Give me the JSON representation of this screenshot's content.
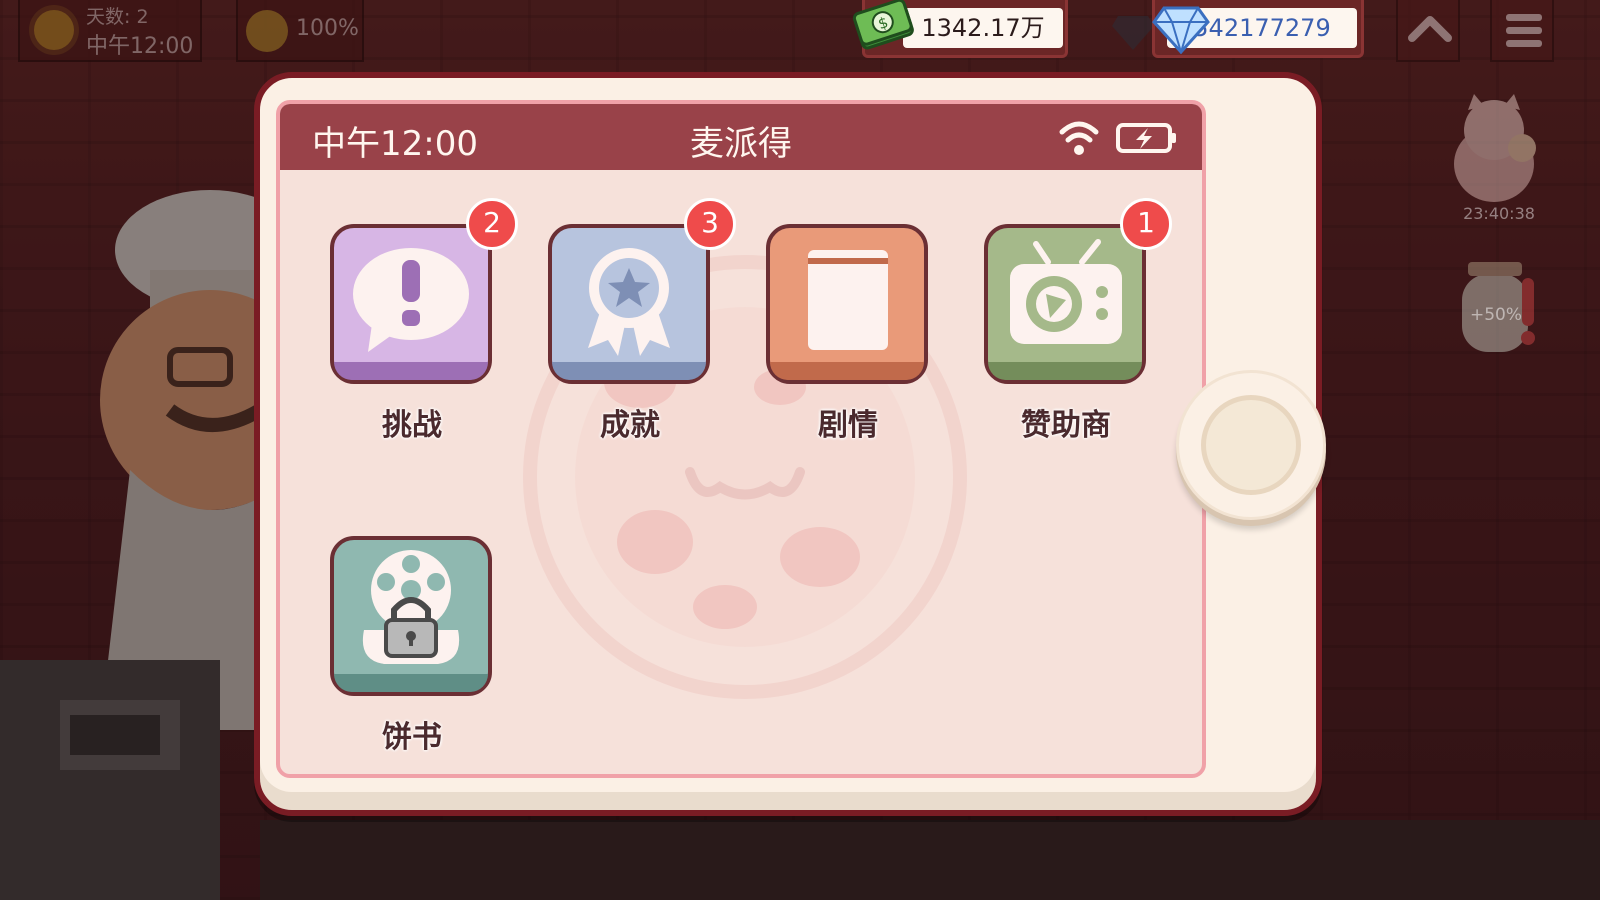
{
  "hud": {
    "day_label": "天数: 2",
    "time": "中午12:00",
    "mood_percent": "100%",
    "money": "1342.17万",
    "gems": "542177279",
    "side_timer": "23:40:38",
    "jar_bonus": "+50%"
  },
  "tablet": {
    "status_time": "中午12:00",
    "app_title": "麦派得"
  },
  "apps": [
    {
      "label": "挑战",
      "badge": "2",
      "color": "#d7b6e5",
      "shade": "#9d6fb5"
    },
    {
      "label": "成就",
      "badge": "3",
      "color": "#b7c4de",
      "shade": "#7e8fb5"
    },
    {
      "label": "剧情",
      "badge": "",
      "color": "#e99a79",
      "shade": "#c16a4b"
    },
    {
      "label": "赞助商",
      "badge": "1",
      "color": "#a5b98a",
      "shade": "#748d5b"
    },
    {
      "label": "饼书",
      "badge": "",
      "color": "#8fb8b0",
      "shade": "#5f8e86"
    }
  ],
  "icons": [
    "sun-icon",
    "smile-icon",
    "money-icon",
    "gem-icon",
    "chevron-up-icon",
    "menu-icon",
    "wifi-icon",
    "battery-icon",
    "speech-exclamation-icon",
    "award-star-icon",
    "book-icon",
    "tv-pizza-icon",
    "film-lock-icon"
  ]
}
